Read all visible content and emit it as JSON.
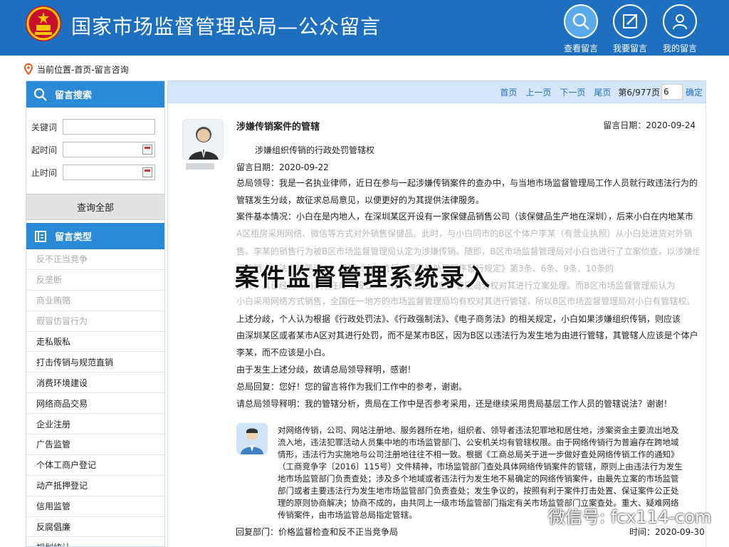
{
  "header": {
    "title": "国家市场监督管理总局—公众留言",
    "buttons": [
      {
        "label": "查看留言",
        "icon": "search-icon"
      },
      {
        "label": "我要留言",
        "icon": "edit-icon"
      },
      {
        "label": "我的留言",
        "icon": "user-icon"
      }
    ]
  },
  "breadcrumb": "当前位置-首页-留言咨询",
  "sidebar": {
    "search_title": "留言搜索",
    "keyword_label": "关键词",
    "start_label": "起时间",
    "end_label": "止时间",
    "query_all": "查询全部",
    "types_title": "留言类型",
    "types": [
      "反不正当竞争",
      "反垄断",
      "商业贿赂",
      "假冒仿冒行为",
      "走私贩私",
      "打击传销与规范直销",
      "消费环境建设",
      "网络商品交易",
      "企业注册",
      "广告监管",
      "个体工商户登记",
      "动产抵押登记",
      "信用监管",
      "反腐倡廉",
      "规划统计"
    ]
  },
  "pager": {
    "first": "首页",
    "prev": "上一页",
    "next": "下一页",
    "last": "尾页",
    "page_info": "第6/977页",
    "page_input": "6",
    "confirm": "确定"
  },
  "message": {
    "title": "涉嫌传销案件的管辖",
    "date": "留言日期：2020-09-24",
    "subtitle": "涉嫌组织传销的行政处罚管辖权",
    "lines": [
      "留言日期：2020-09-22",
      "总局领导：我是一名执业律师，近日在参与一起涉嫌传销案件的查办中，与当地市场监督管理局工作人员就行政违法行为的",
      "管辖发生分歧，故征求总局意见，以便更好的为其提供法律服务。",
      "案件基本情况：小白在是内地人，在深圳某区开设有一家保健品销售公司（该保健品生产地在深圳），后来小白在内地某市",
      "A区租房采用网络、微信等方式对外销售保健品。此时，与小白同市的B区个体户李某（有营业执照）从小白处进货对外销",
      "售。李某的销售行为被B区市场监督管理局认定为涉嫌传销。随即，B区市场监督管理局对小白也进行了立案侦查，以涉嫌组",
      "织传销，违法所得等调查。根据《市场监督管理行政处罚程序暂行规定》第3条、6条、9条、10条的",
      "规定，且已经对四川某某在广东设立的公司，B区市场监督管理局无权对其进行立案处理。而B区市场监督管理局认为",
      "小白采用网络方式销售，全国任一地方的市场监督管理局均有权对其进行管辖，所以B区市场监督管理局对小白有管辖权。",
      "上述分歧，个人认为根据《行政处罚法》、《行政强制法》、《电子商务法》的相关规定，小白如果涉嫌组织传销，则应该",
      "由深圳某区或者某市A区对其进行处罚，而不是某市B区，因为B区以违法行为发生地为由进行管辖，其管辖人应该是个体户",
      "李某，而不应该是小白。",
      "由于发生上述分歧，故请总局领导释明，感谢！",
      "总局回复：您好！您的留言将作为我们工作中的参考，谢谢。",
      "请总局领导释明：我的管辖分析，贵局在工作中是否参考采用，还是继续采用贵局基层工作人员的管辖说法？谢谢！"
    ]
  },
  "overlay_title": "案件监督管理系统录入",
  "reply": {
    "lines": [
      "对网络传销，公司、网站注册地、服务器所在地，组织者、领导者违法犯罪地和居住地，涉案资金主要流出地及",
      "流入地，违法犯罪活动人员集中地的市场监管部门、公安机关均有管辖权限。由于网络传销行为普遍存在跨地域",
      "情形，违法行为实施地与公司注册地往往不相一致。根据《工商总局关于进一步做好查处网络传销工作的通知》",
      "（工商竞争字〔2016〕115号）文件精神，市场监管部门查处具体网络传销案件的管辖，原则上由违法行为发生",
      "地市场监管部门负责查处；涉及多个地域或者违法行为发生地不易确定的网络传销案件，由最先立案的市场监管",
      "部门或者主要违法行为发生地市场监管部门负责查处；发生争议的，按照有利于案件打击处置、保证案件公正处",
      "理的原则协商解决；协商不成的，由共同上一级市场监管部门指定有关市场监管部门立案查处。重大、疑难网络",
      "传销案件，由市场监管总局指定管辖。"
    ],
    "dept": "回复部门：价格监督检查和反不正当竞争局",
    "time": "时间：2020-09-30"
  },
  "watermark": "微信号: fcx114-com",
  "colors": {
    "header_bg": "#1e6fc0",
    "sidebar_head": "#2b8ad7",
    "pager_bg": "#d4e6f7",
    "link": "#1e6fc0"
  }
}
